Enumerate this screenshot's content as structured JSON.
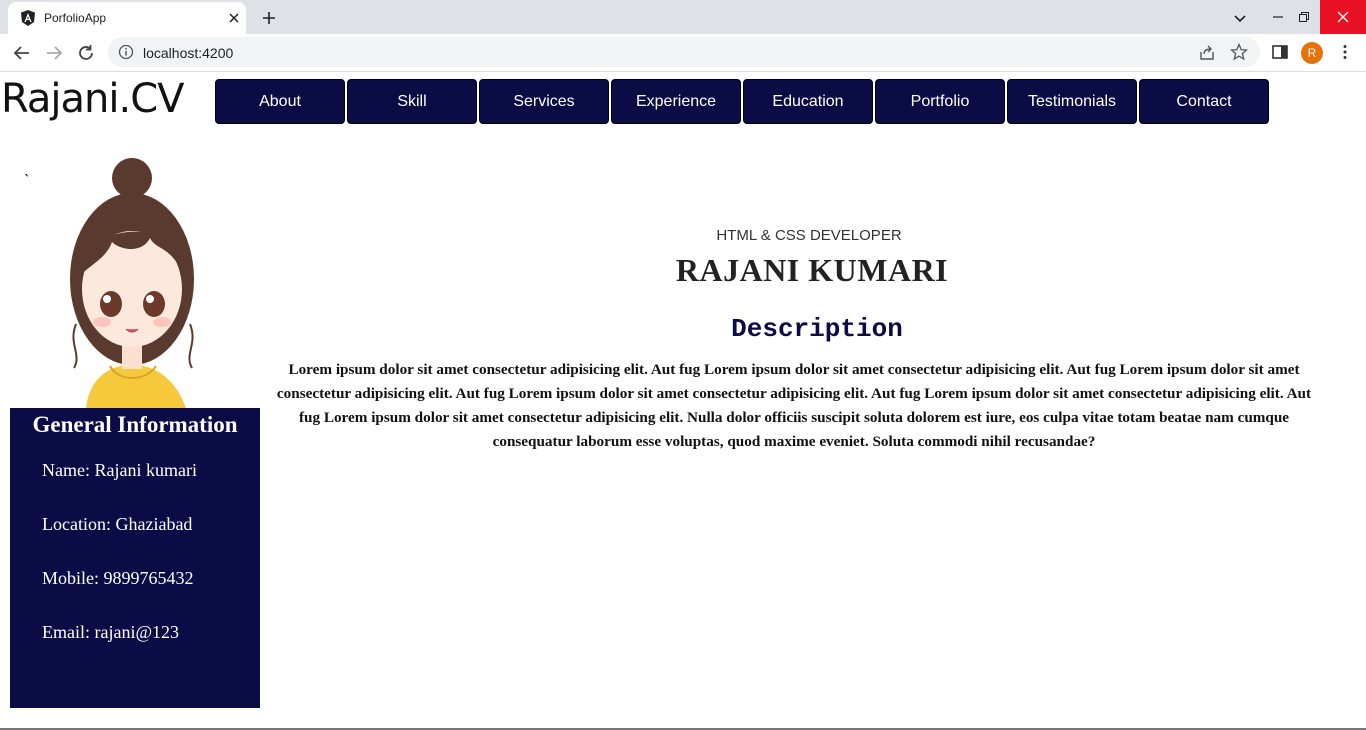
{
  "browser": {
    "tab_title": "PorfolioApp",
    "url": "localhost:4200",
    "profile_initial": "R"
  },
  "site": {
    "logo": "Rajani.CV",
    "nav": [
      "About",
      "Skill",
      "Services",
      "Experience",
      "Education",
      "Portfolio",
      "Testimonials",
      "Contact"
    ]
  },
  "hero": {
    "subtitle": "HTML & CSS DEVELOPER",
    "name": "RAJANI KUMARI",
    "description_title": "Description",
    "description": "Lorem ipsum dolor sit amet consectetur adipisicing elit. Aut fug Lorem ipsum dolor sit amet consectetur adipisicing elit. Aut fug Lorem ipsum dolor sit amet consectetur adipisicing elit. Aut fug Lorem ipsum dolor sit amet consectetur adipisicing elit. Aut fug Lorem ipsum dolor sit amet consectetur adipisicing elit. Aut fug Lorem ipsum dolor sit amet consectetur adipisicing elit. Nulla dolor officiis suscipit soluta dolorem est iure, eos culpa vitae totam beatae nam cumque consequatur laborum esse voluptas, quod maxime eveniet. Soluta commodi nihil recusandae?"
  },
  "info": {
    "title": "General Information",
    "name": "Name: Rajani kumari",
    "location": "Location: Ghaziabad",
    "mobile": "Mobile: 9899765432",
    "email": "Email: rajani@123"
  },
  "colors": {
    "navy": "#0b0b45",
    "chrome_bg": "#dee1e6",
    "close_red": "#e81123",
    "profile_orange": "#e8710a"
  },
  "icons": [
    "angular-icon",
    "close-icon",
    "plus-icon",
    "chevron-down-icon",
    "minimize-icon",
    "restore-icon",
    "back-icon",
    "forward-icon",
    "reload-icon",
    "info-icon",
    "share-icon",
    "star-icon",
    "sidepanel-icon",
    "kebab-menu-icon"
  ]
}
